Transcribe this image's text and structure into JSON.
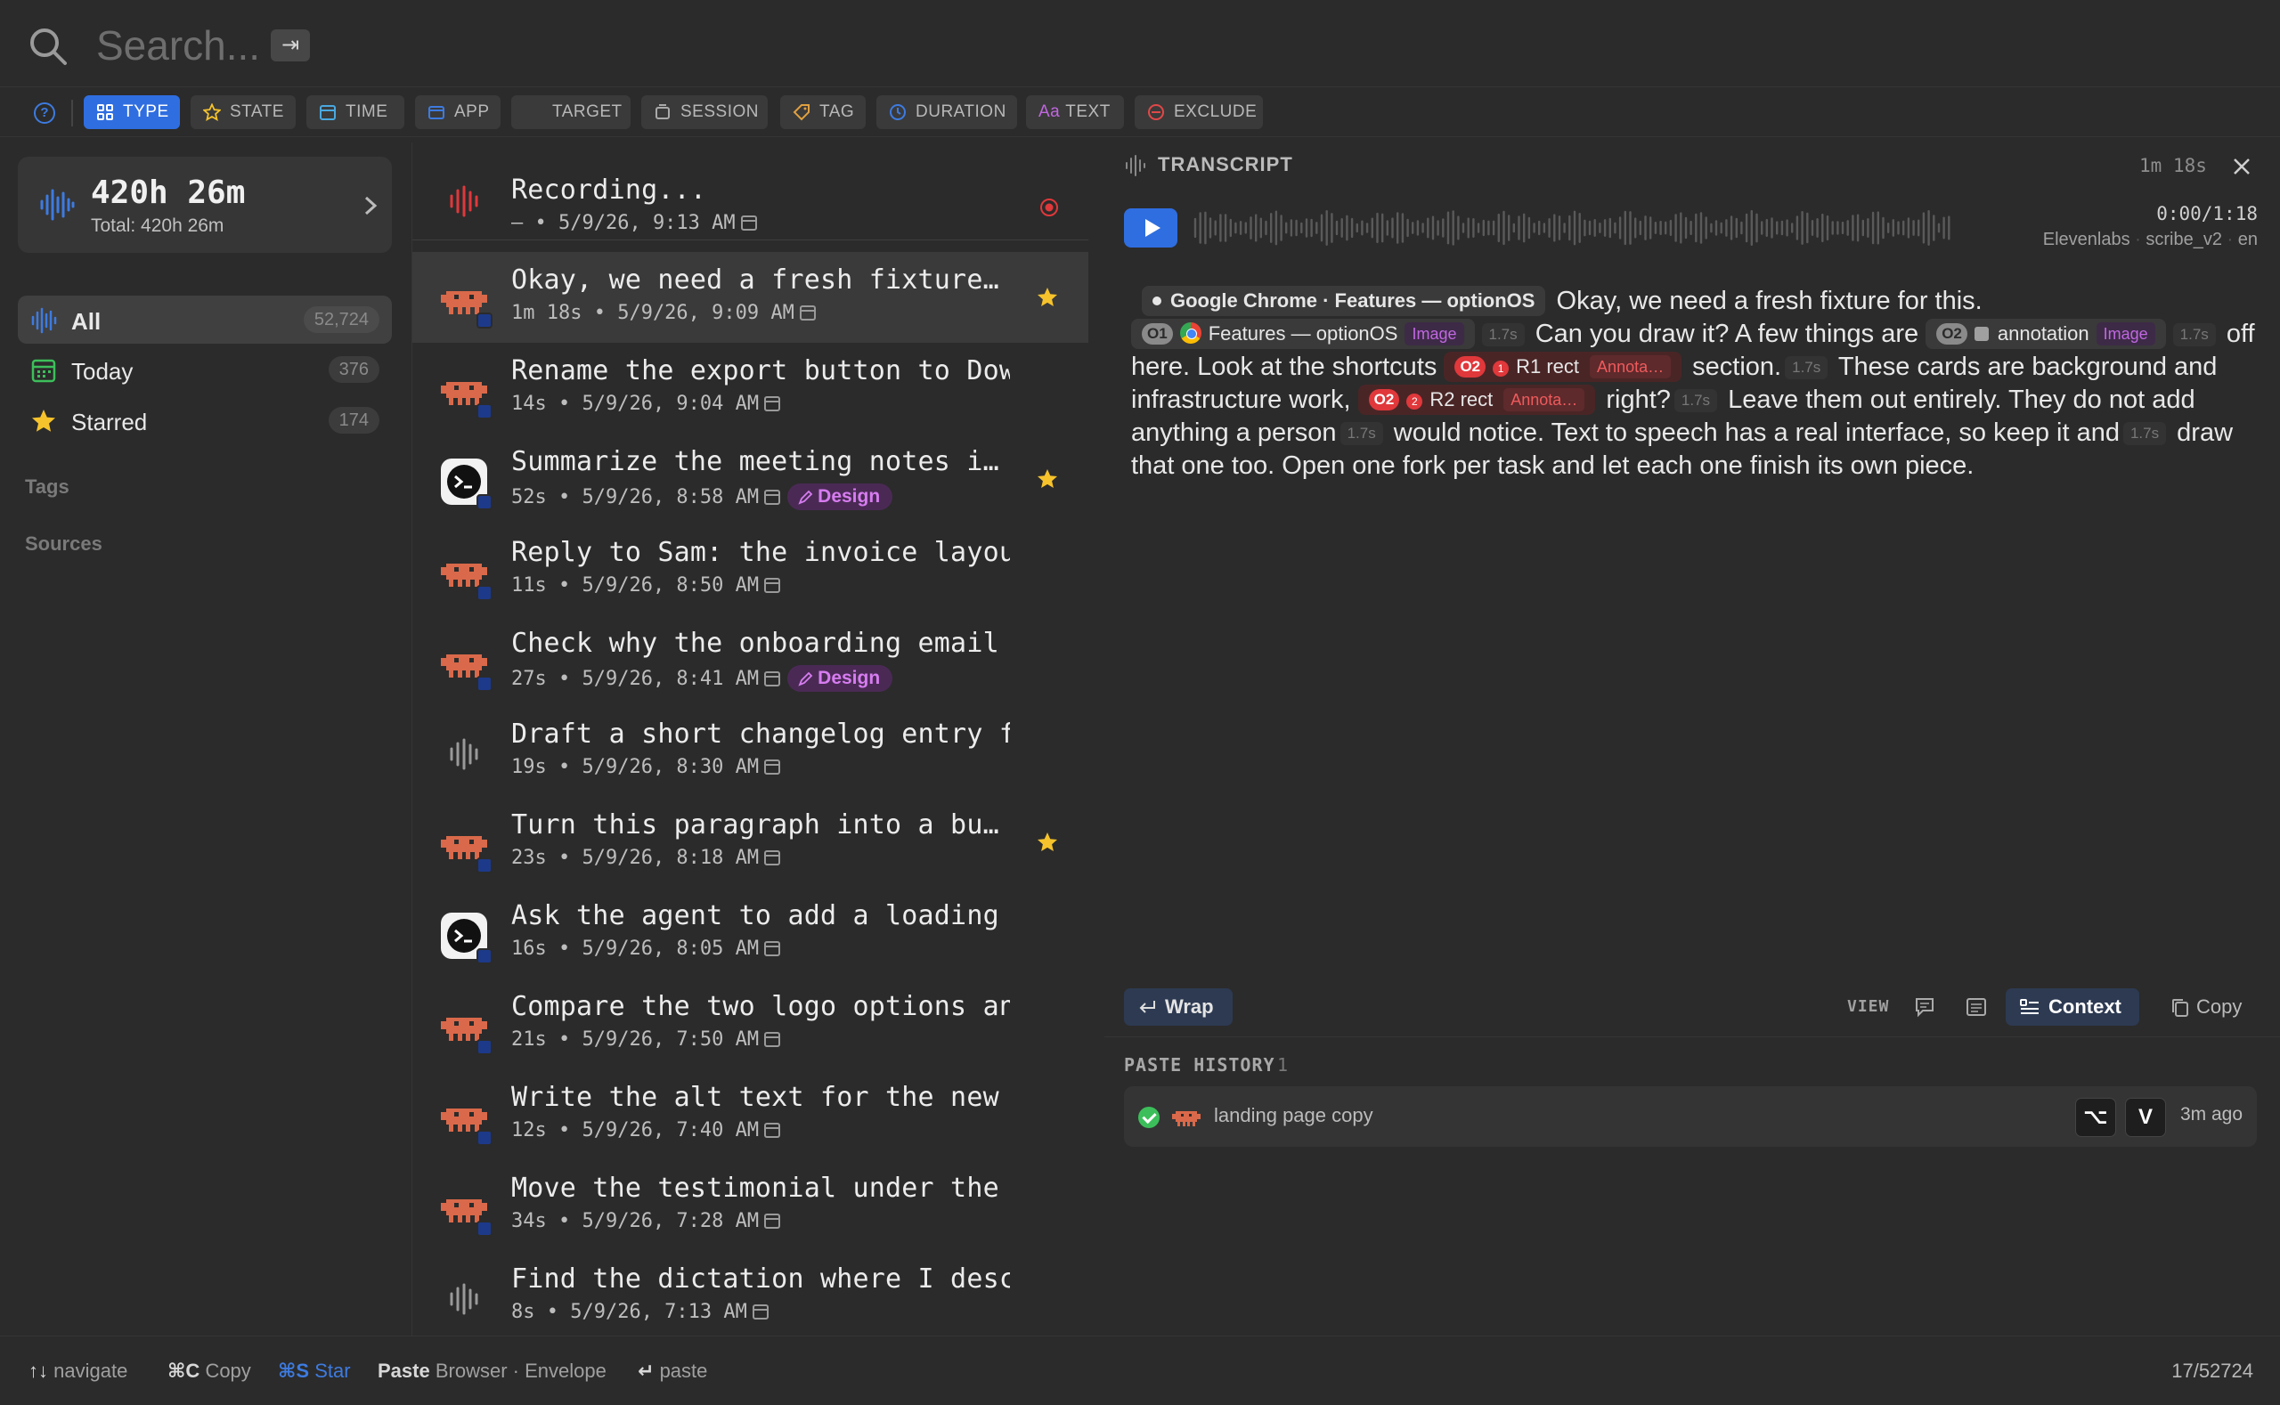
{
  "search": {
    "placeholder": "Search...",
    "tab_key": "⇥"
  },
  "filters": {
    "help": "?",
    "chips": [
      {
        "label": "TYPE",
        "icon": "grid-icon",
        "active": true
      },
      {
        "label": "STATE",
        "icon": "star-outline-icon"
      },
      {
        "label": "TIME",
        "icon": "calendar-icon"
      },
      {
        "label": "APP",
        "icon": "window-icon"
      },
      {
        "label": "TARGET",
        "icon": "target-icon"
      },
      {
        "label": "SESSION",
        "icon": "session-icon"
      },
      {
        "label": "TAG",
        "icon": "tag-icon"
      },
      {
        "label": "DURATION",
        "icon": "clock-icon"
      },
      {
        "label": "TEXT",
        "icon": "text-icon",
        "prefix": "Aa"
      },
      {
        "label": "EXCLUDE",
        "icon": "exclude-icon"
      }
    ]
  },
  "sidebar": {
    "stats": {
      "total_big": "420h 26m",
      "total_sub": "Total: 420h 26m"
    },
    "nav": [
      {
        "label": "All",
        "count": "52,724",
        "icon": "waveform-icon"
      },
      {
        "label": "Today",
        "count": "376",
        "icon": "calendar-icon"
      },
      {
        "label": "Starred",
        "count": "174",
        "icon": "star-icon"
      }
    ],
    "tags_header": "Tags",
    "sources_header": "Sources"
  },
  "recording": {
    "title": "Recording...",
    "meta": "— • 5/9/26, 9:13 AM"
  },
  "items": [
    {
      "title": "Okay, we need a fresh fixture…",
      "meta": "1m 18s • 5/9/26, 9:09 AM",
      "icon": "app-robot-icon",
      "starred": true,
      "selected": true
    },
    {
      "title": "Rename the export button to Down…",
      "meta": "14s • 5/9/26, 9:04 AM",
      "icon": "app-robot-icon"
    },
    {
      "title": "Summarize the meeting notes i…",
      "meta": "52s • 5/9/26, 8:58 AM",
      "icon": "app-terminal-icon",
      "starred": true,
      "tag": "Design"
    },
    {
      "title": "Reply to Sam: the invoice layout…",
      "meta": "11s • 5/9/26, 8:50 AM",
      "icon": "app-robot-icon"
    },
    {
      "title": "Check why the onboarding email a…",
      "meta": "27s • 5/9/26, 8:41 AM",
      "icon": "app-robot-icon",
      "tag": "Design"
    },
    {
      "title": "Draft a short changelog entry fo…",
      "meta": "19s • 5/9/26, 8:30 AM",
      "icon": "waveform-icon"
    },
    {
      "title": "Turn this paragraph into a bu…",
      "meta": "23s • 5/9/26, 8:18 AM",
      "icon": "app-robot-icon",
      "starred": true
    },
    {
      "title": "Ask the agent to add a loading s…",
      "meta": "16s • 5/9/26, 8:05 AM",
      "icon": "app-terminal-icon"
    },
    {
      "title": "Compare the two logo options and…",
      "meta": "21s • 5/9/26, 7:50 AM",
      "icon": "app-robot-icon"
    },
    {
      "title": "Write the alt text for the new f…",
      "meta": "12s • 5/9/26, 7:40 AM",
      "icon": "app-robot-icon"
    },
    {
      "title": "Move the testimonial under the h…",
      "meta": "34s • 5/9/26, 7:28 AM",
      "icon": "app-robot-icon"
    },
    {
      "title": "Find the dictation where I descr…",
      "meta": "8s • 5/9/26, 7:13 AM",
      "icon": "waveform-icon"
    }
  ],
  "transcript": {
    "title": "TRANSCRIPT",
    "duration": "1m 18s",
    "time_code": "0:00/1:18",
    "provider": "Elevenlabs",
    "model": "scribe_v2",
    "lang": "en",
    "ctx_chrome": "Google Chrome · Features — optionOS",
    "seg1": "Okay, we need a fresh fixture for this.",
    "ctx1_num": "O1",
    "ctx1_label": "Features — optionOS",
    "ctx1_tag": "Image",
    "pause": "1.7s",
    "seg2": "Can you draw it? A few things are",
    "ctx2_num": "O2",
    "ctx2_label": "annotation",
    "ctx2_tag": "Image",
    "seg3": "off here. Look at the shortcuts",
    "r1_num": "O2",
    "r1_n": "1",
    "r1_label": "R1 rect",
    "r1_tag": "Annota…",
    "seg4": "section.",
    "seg5": "These cards are background and infrastructure work,",
    "r2_num": "O2",
    "r2_n": "2",
    "r2_label": "R2 rect",
    "r2_tag": "Annota…",
    "seg6": "right?",
    "seg7": "Leave them out entirely. They do not add anything a person",
    "seg8": "would notice. Text to speech has a real interface, so keep it and",
    "seg9": "draw that one too. Open one fork per task and let each one finish its own piece."
  },
  "toolbar": {
    "wrap": "Wrap",
    "view": "VIEW",
    "context": "Context",
    "copy": "Copy"
  },
  "paste_history": {
    "label": "PASTE HISTORY",
    "count": "1",
    "item": "landing page copy",
    "key1": "⌥",
    "key2": "V",
    "time": "3m ago"
  },
  "statusbar": {
    "navigate_keys": "↑↓",
    "navigate": "navigate",
    "copy_keys": "⌘C",
    "copy": "Copy",
    "star_keys": "⌘S",
    "star": "Star",
    "paste_label": "Paste",
    "paste_target": "Browser · Envelope",
    "enter_key": "↵",
    "enter": "paste",
    "position": "17/52724"
  },
  "colors": {
    "accent": "#2f6ee0",
    "star": "#f6c32c",
    "recording": "#e0383b",
    "design_tag": "#d77cf0",
    "success": "#3cbf5a"
  }
}
